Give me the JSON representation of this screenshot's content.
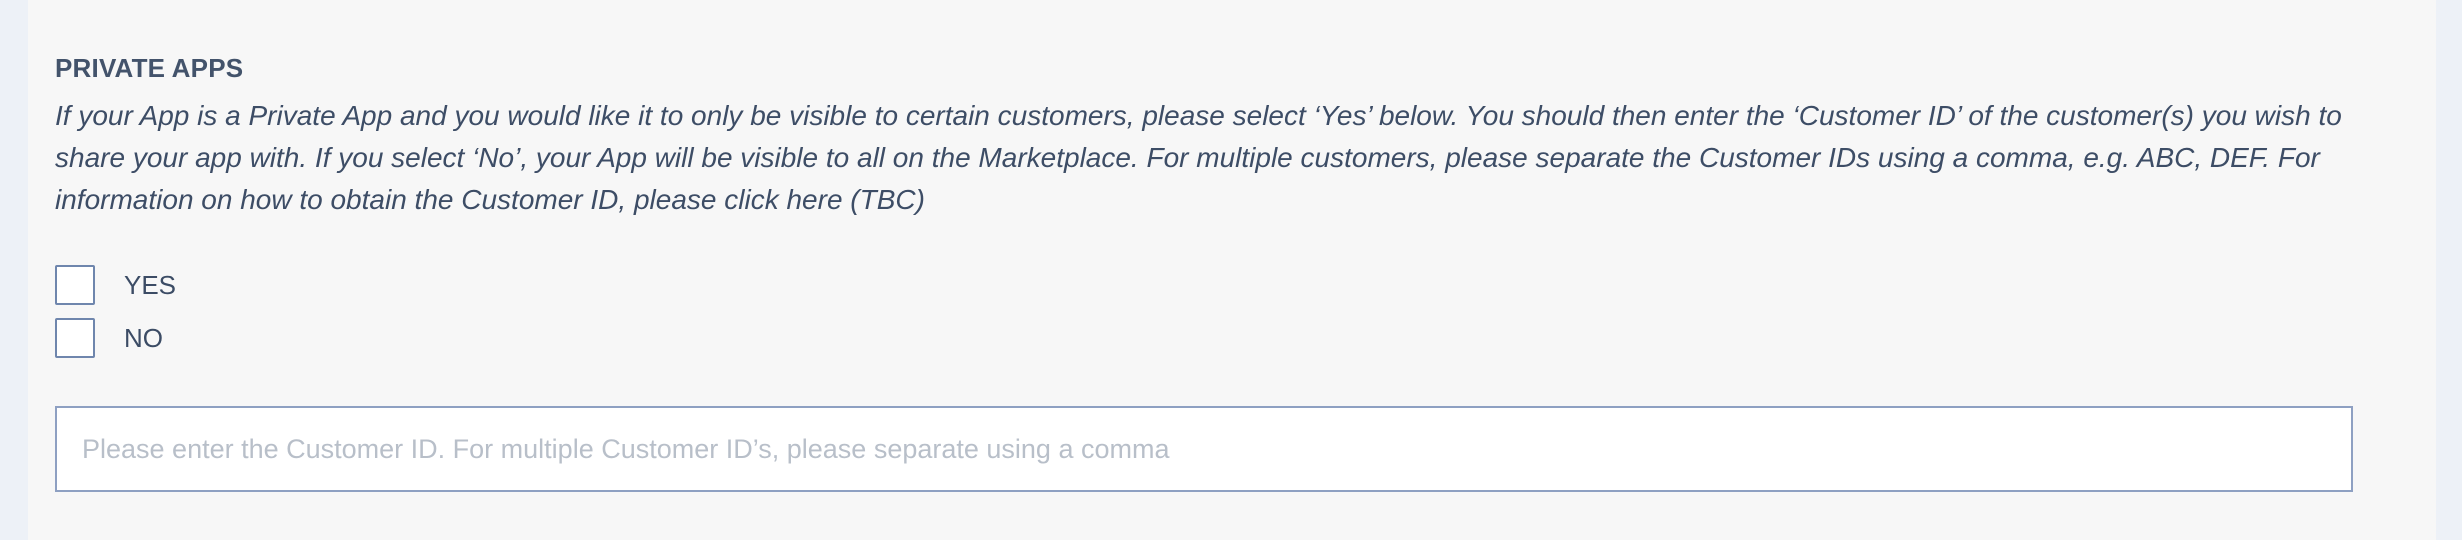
{
  "section": {
    "title": "PRIVATE APPS",
    "description": "If your App is a Private App and you would like it to only be visible to certain customers, please select ‘Yes’ below. You should then enter the ‘Customer ID’ of the customer(s) you wish to share your app with. If you select ‘No’, your App will be visible to all on the Marketplace. For multiple customers, please separate the Customer IDs using a comma, e.g. ABC, DEF. For information on how to obtain the Customer ID, please click here (TBC)"
  },
  "options": {
    "yes_label": "YES",
    "no_label": "NO",
    "yes_checked": false,
    "no_checked": false
  },
  "customer_id_input": {
    "value": "",
    "placeholder": "Please enter the Customer ID. For multiple Customer ID’s, please separate using a comma"
  },
  "colors": {
    "background": "#edf1f7",
    "panel": "#f7f7f7",
    "text": "#3d4d66",
    "checkbox_border": "#6f86ad",
    "input_border": "#8ea0c2",
    "placeholder": "#b8bfc9"
  }
}
